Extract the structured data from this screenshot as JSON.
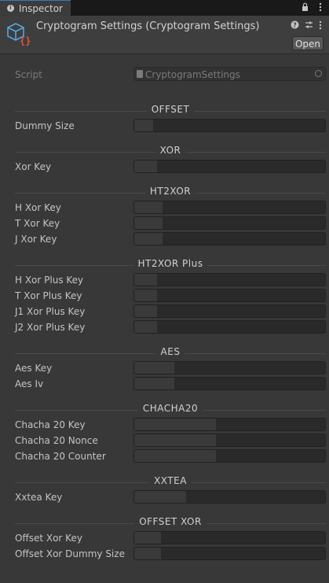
{
  "tab": {
    "label": "Inspector",
    "icon": "info-icon"
  },
  "header": {
    "title": "Cryptogram Settings (Cryptogram Settings)",
    "open_label": "Open"
  },
  "script": {
    "label": "Script",
    "value": "CryptogramSettings"
  },
  "sections": [
    {
      "title": "OFFSET",
      "fields": [
        {
          "label": "Dummy Size",
          "fill": 0.1
        }
      ]
    },
    {
      "title": "XOR",
      "fields": [
        {
          "label": "Xor Key",
          "fill": 0.12
        }
      ]
    },
    {
      "title": "HT2XOR",
      "fields": [
        {
          "label": "H Xor Key",
          "fill": 0.15
        },
        {
          "label": "T Xor Key",
          "fill": 0.15
        },
        {
          "label": "J Xor Key",
          "fill": 0.15
        }
      ]
    },
    {
      "title": "HT2XOR Plus",
      "fields": [
        {
          "label": "H Xor Plus Key",
          "fill": 0.12
        },
        {
          "label": "T Xor Plus Key",
          "fill": 0.12
        },
        {
          "label": "J1 Xor Plus Key",
          "fill": 0.12
        },
        {
          "label": "J2 Xor Plus Key",
          "fill": 0.12
        }
      ]
    },
    {
      "title": "AES",
      "fields": [
        {
          "label": "Aes Key",
          "fill": 0.21
        },
        {
          "label": "Aes Iv",
          "fill": 0.21
        }
      ]
    },
    {
      "title": "CHACHA20",
      "fields": [
        {
          "label": "Chacha 20 Key",
          "fill": 0.43
        },
        {
          "label": "Chacha 20 Nonce",
          "fill": 0.43
        },
        {
          "label": "Chacha 20 Counter",
          "fill": 0.43
        }
      ]
    },
    {
      "title": "XXTEA",
      "fields": [
        {
          "label": "Xxtea Key",
          "fill": 0.27
        }
      ]
    },
    {
      "title": "OFFSET XOR",
      "fields": [
        {
          "label": "Offset Xor Key",
          "fill": 0.14
        },
        {
          "label": "Offset Xor Dummy Size",
          "fill": 0.14
        }
      ]
    }
  ]
}
